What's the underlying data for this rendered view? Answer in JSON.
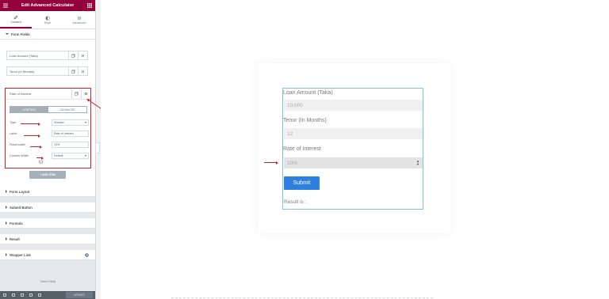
{
  "panel": {
    "title": "Edit Advanced Calculator",
    "tabs": [
      {
        "label": "Content",
        "icon": "pencil-icon"
      },
      {
        "label": "Style",
        "icon": "half-circle-icon"
      },
      {
        "label": "Advanced",
        "icon": "gear-icon"
      }
    ],
    "sections": {
      "form_fields": "Form Fields",
      "form_layout": "Form Layout",
      "submit_button": "Submit Button",
      "formula": "Formula",
      "result": "Result",
      "wrapper_link": "Wrapper Link"
    },
    "items": [
      "Loan Amount (Taka)",
      "Tenor (In Months)",
      "Rate of Interest"
    ],
    "active_item": {
      "label": "Rate of Interest",
      "tabs": [
        "CONTENT",
        "ADVANCED"
      ],
      "controls": [
        {
          "name": "Type",
          "value": "Number"
        },
        {
          "name": "Label",
          "value": "Rate of Interest"
        },
        {
          "name": "Placeholder",
          "value": "10%"
        },
        {
          "name": "Column Width",
          "value": "Default"
        }
      ]
    },
    "add_item": "+ ADD ITEM",
    "need_help": "Need Help",
    "update": "UPDATE"
  },
  "preview": {
    "fields": [
      {
        "label": "Loan Amount (Taka)",
        "placeholder": "10,000"
      },
      {
        "label": "Tenor (In Months)",
        "placeholder": "12"
      },
      {
        "label": "Rate of Interest",
        "placeholder": "10%"
      }
    ],
    "submit": "Submit",
    "result": "Result is :"
  },
  "colors": {
    "accent": "#93003c",
    "annotation": "#c62828",
    "button": "#2f7fe0"
  }
}
